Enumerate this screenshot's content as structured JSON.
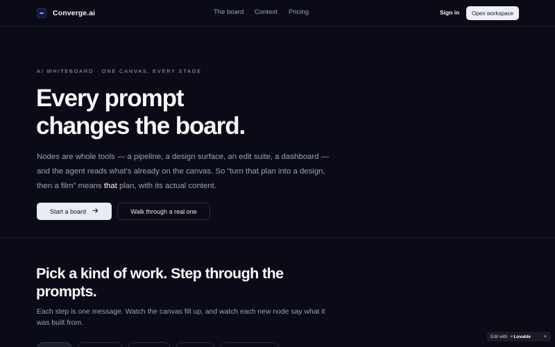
{
  "header": {
    "brand": "Converge.ai",
    "logo_icon": "converge-logo-icon",
    "nav": [
      "The board",
      "Context",
      "Pricing"
    ],
    "sign_in": "Sign in",
    "open_workspace": "Open workspace"
  },
  "hero": {
    "eyebrow": "AI WHITEBOARD · ONE CANVAS, EVERY STAGE",
    "headline_line1": "Every prompt",
    "headline_line2": "changes the board.",
    "lede_part1": "Nodes are whole tools — a pipeline, a design surface, an edit suite, a dashboard — and the agent reads what's already on the canvas. So “turn that plan into a design, then a film” means ",
    "lede_highlight": "that",
    "lede_part2": " plan, with its actual content.",
    "primary_button": "Start a board",
    "primary_button_icon": "arrow-right-icon",
    "secondary_button": "Walk through a real one"
  },
  "section": {
    "title": "Pick a kind of work. Step through the prompts.",
    "description": "Each step is one message. Watch the canvas fill up, and watch each new node say what it was built from."
  },
  "badge": {
    "prefix": "Edit with",
    "brand": "Lovable",
    "close": "×"
  },
  "colors": {
    "background": "#0a0b16",
    "primary_button_bg": "#e8ebf3",
    "muted_text": "#9ea2b3",
    "lovable_heart": "#ff5a5f"
  }
}
